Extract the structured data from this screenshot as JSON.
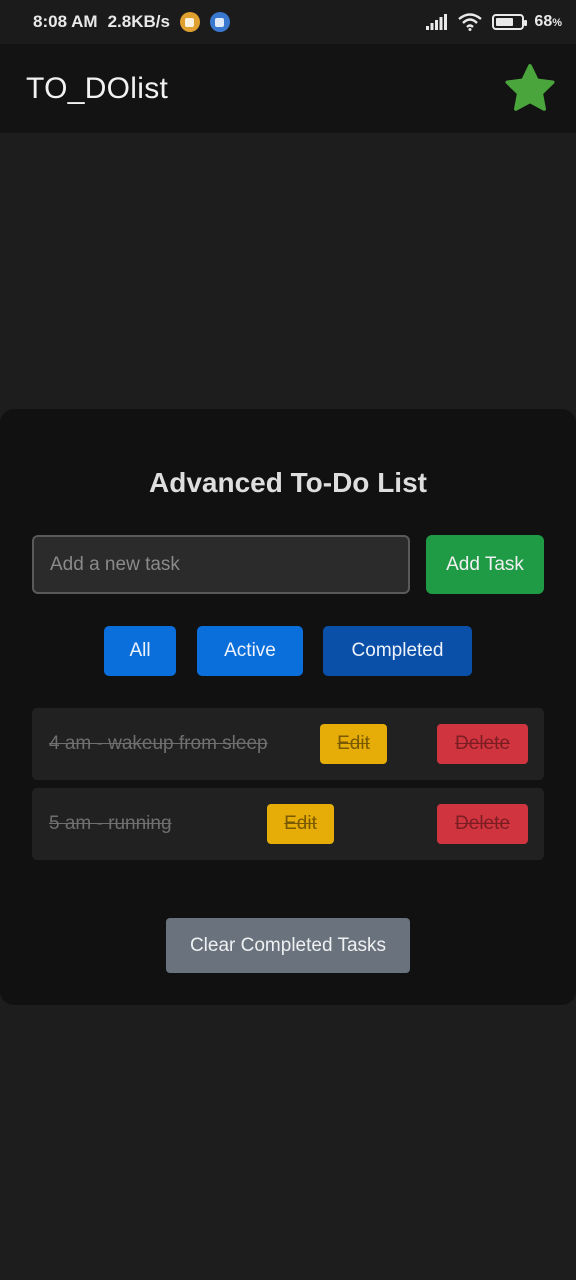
{
  "status_bar": {
    "time": "8:08 AM",
    "net_speed": "2.8KB/s",
    "battery_percent": "68",
    "battery_unit": "%",
    "battery_level": 0.68
  },
  "app_bar": {
    "title": "TO_DOlist",
    "star_icon_color": "#4aa63c"
  },
  "card": {
    "title": "Advanced To-Do List",
    "input_placeholder": "Add a new task",
    "input_value": "",
    "add_button": "Add Task",
    "filters": [
      "All",
      "Active",
      "Completed"
    ],
    "selected_filter": "Completed",
    "tasks": [
      {
        "text": "4 am - wakeup from sleep",
        "edit_label": "Edit",
        "delete_label": "Delete",
        "completed": true
      },
      {
        "text": "5 am - running",
        "edit_label": "Edit",
        "delete_label": "Delete",
        "completed": true
      }
    ],
    "clear_button": "Clear Completed Tasks"
  },
  "colors": {
    "add_button": "#1f9b46",
    "filter_button": "#0a6fdb",
    "filter_selected": "#0a4fa8",
    "edit_button": "#e6ac08",
    "delete_button": "#d0343f",
    "clear_button": "#6a737d"
  }
}
